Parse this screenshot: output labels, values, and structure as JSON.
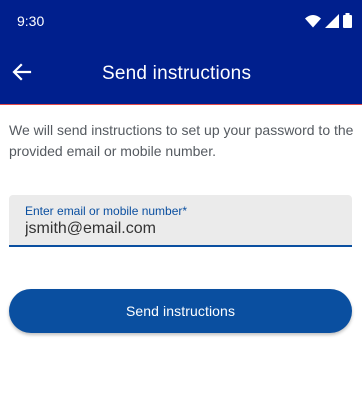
{
  "status_bar": {
    "time": "9:30",
    "icons": [
      "wifi-icon",
      "signal-icon",
      "battery-icon"
    ]
  },
  "app_bar": {
    "back_icon": "arrow-back-icon",
    "title": "Send instructions"
  },
  "main": {
    "description": "We will send instructions to set up your password to the provided email or mobile number.",
    "field": {
      "label": "Enter email  or mobile number*",
      "value": "jsmith@email.com"
    },
    "submit_label": "Send instructions"
  },
  "colors": {
    "header_bg": "#001f8d",
    "accent": "#0a4fa0",
    "field_bg": "#ebebeb",
    "header_divider": "#e24a4a"
  }
}
